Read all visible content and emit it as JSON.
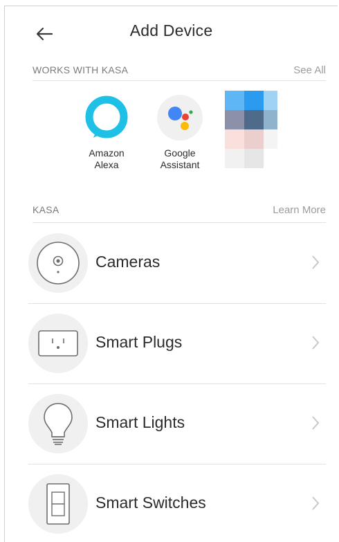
{
  "header": {
    "title": "Add Device"
  },
  "works_with": {
    "label": "WORKS WITH KASA",
    "link": "See All",
    "partners": [
      {
        "name": "Amazon\nAlexa",
        "icon": "alexa-icon"
      },
      {
        "name": "Google\nAssistant",
        "icon": "google-assistant-icon"
      }
    ]
  },
  "kasa": {
    "label": "KASA",
    "link": "Learn More",
    "items": [
      {
        "label": "Cameras",
        "icon": "camera-icon"
      },
      {
        "label": "Smart Plugs",
        "icon": "plug-icon"
      },
      {
        "label": "Smart Lights",
        "icon": "bulb-icon"
      },
      {
        "label": "Smart Switches",
        "icon": "switch-icon"
      }
    ]
  },
  "colors": {
    "alexa": "#1ec0e6",
    "google_blue": "#4285f4",
    "google_red": "#ea4335",
    "google_yellow": "#fbbc05",
    "google_green": "#34a853",
    "divider": "#e2e2e2"
  }
}
